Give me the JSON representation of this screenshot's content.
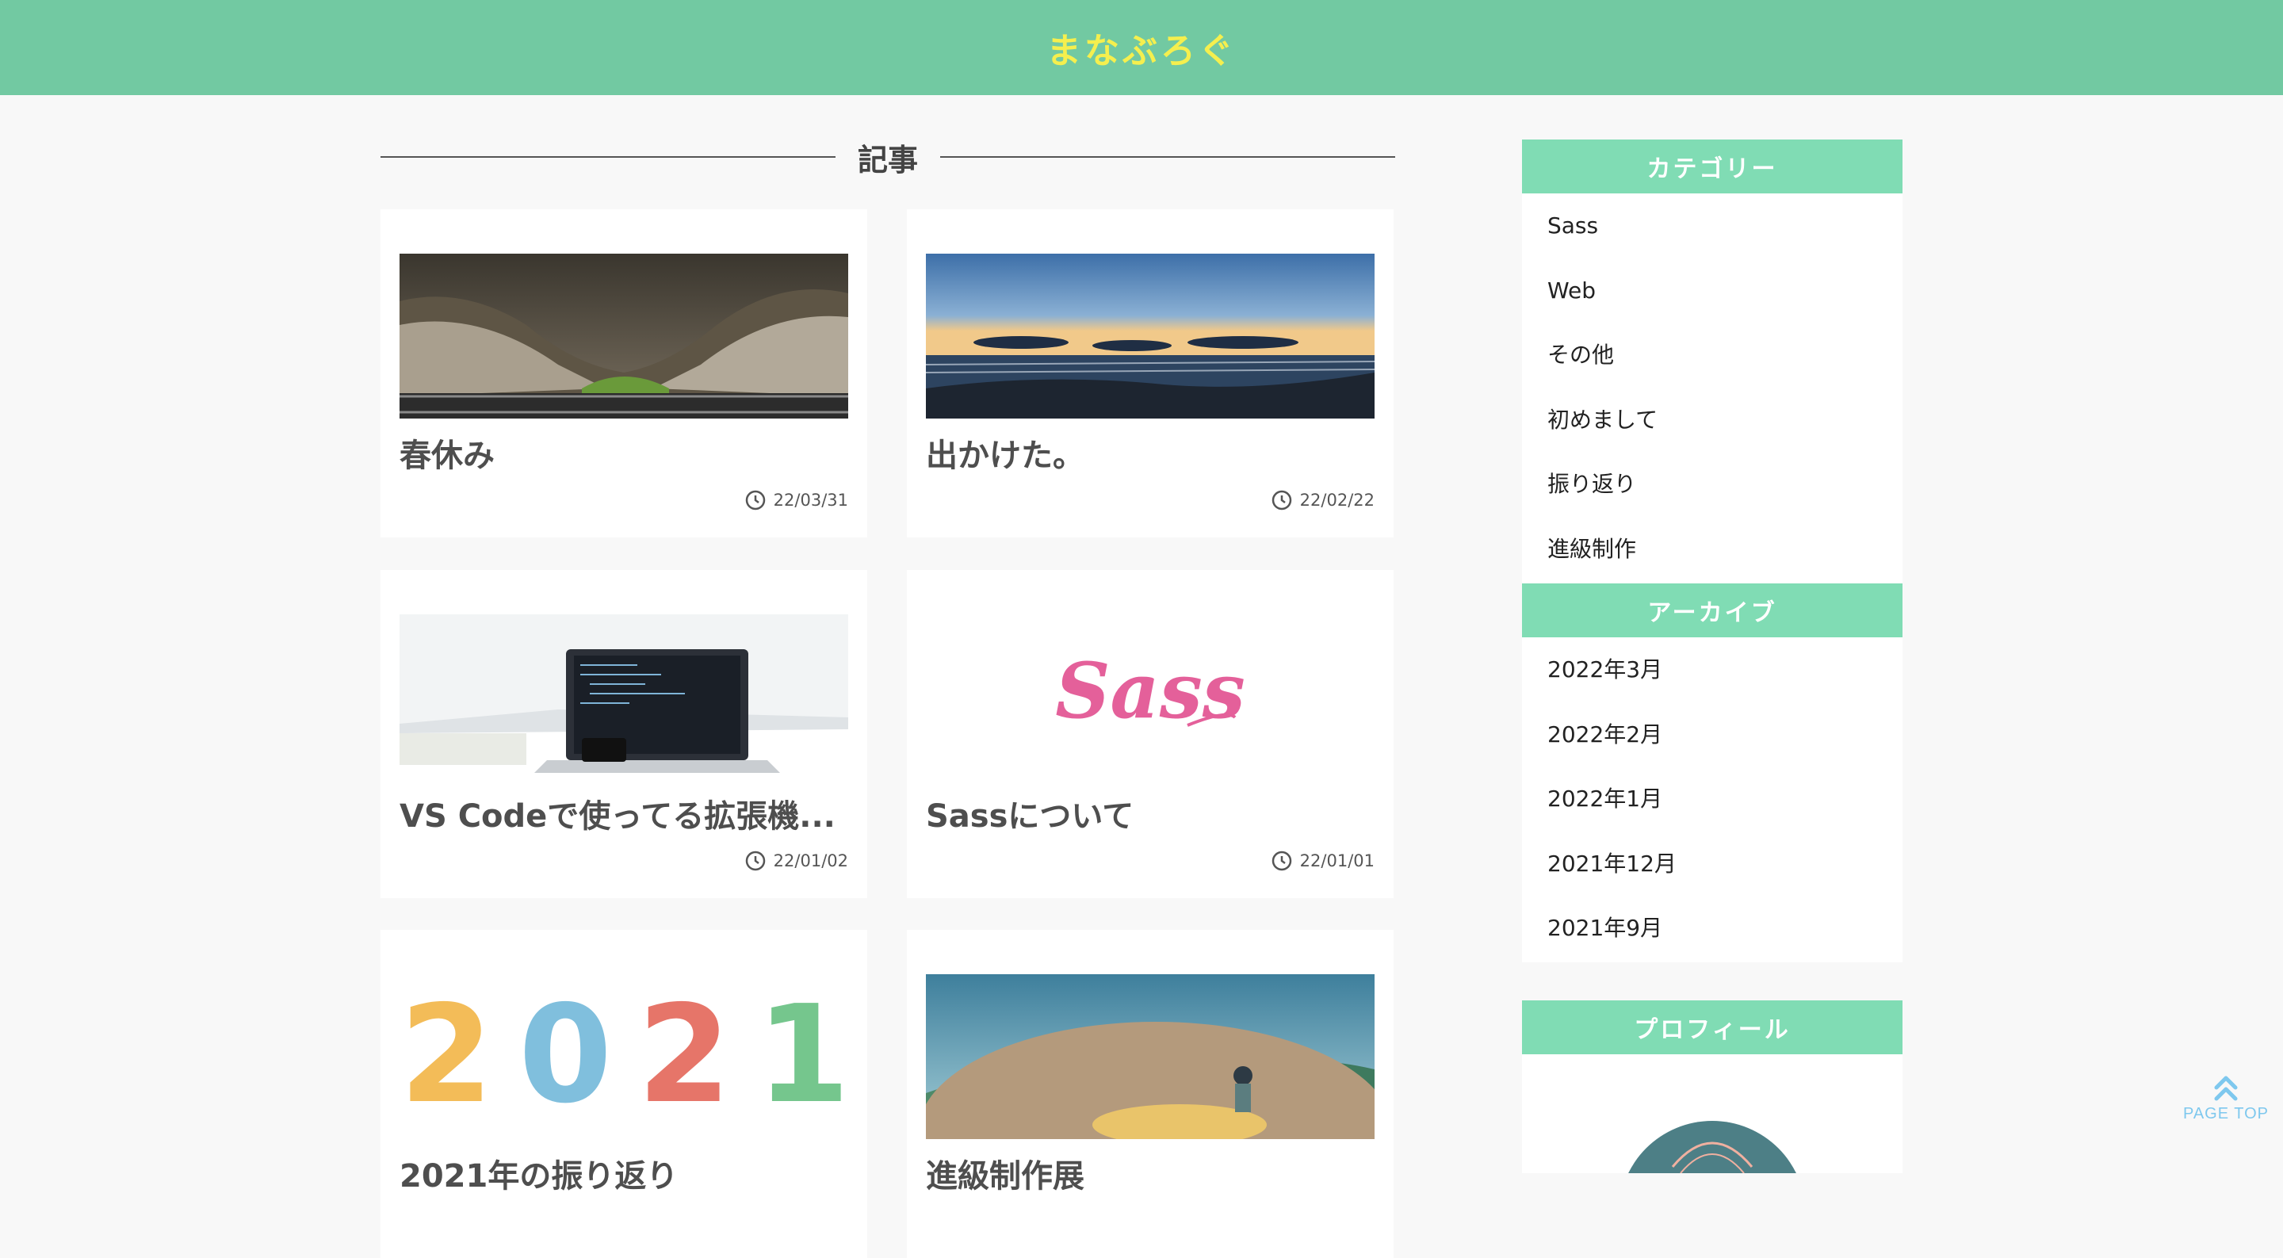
{
  "header": {
    "site_title": "まなぶろぐ"
  },
  "main": {
    "section_title": "記事",
    "posts": [
      {
        "title": "春休み",
        "date": "22/03/31"
      },
      {
        "title": "出かけた。",
        "date": "22/02/22"
      },
      {
        "title": "VS Codeで使ってる拡張機...",
        "date": "22/01/02"
      },
      {
        "title": "Sassについて",
        "date": "22/01/01"
      },
      {
        "title": "2021年の振り返り",
        "date": ""
      },
      {
        "title": "進級制作展",
        "date": ""
      }
    ]
  },
  "sidebar": {
    "categories": {
      "title": "カテゴリー",
      "items": [
        "Sass",
        "Web",
        "その他",
        "初めまして",
        "振り返り",
        "進級制作"
      ]
    },
    "archives": {
      "title": "アーカイブ",
      "items": [
        "2022年3月",
        "2022年2月",
        "2022年1月",
        "2021年12月",
        "2021年9月"
      ]
    },
    "profile": {
      "title": "プロフィール"
    }
  },
  "page_top": {
    "label": "PAGE TOP"
  },
  "colors": {
    "header": "#72c9a2",
    "title": "#f5ef4e",
    "widget_head": "#80dcb4",
    "page_top": "#7ec8ee"
  }
}
